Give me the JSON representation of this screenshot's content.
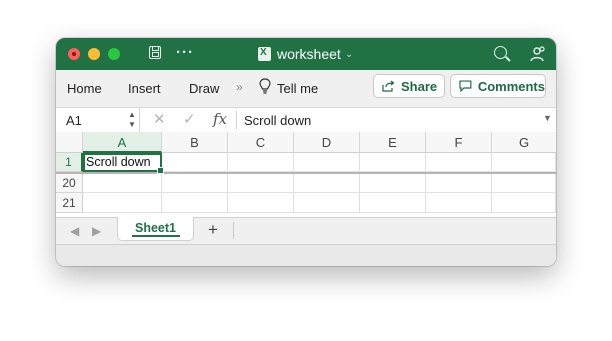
{
  "window": {
    "title": "worksheet"
  },
  "ribbon": {
    "tabs": [
      "Home",
      "Insert",
      "Draw"
    ],
    "overflow": "»",
    "tell_me": "Tell me",
    "share_label": "Share",
    "comments_label": "Comments"
  },
  "formula_bar": {
    "name_box": "A1",
    "fx_label": "fx",
    "content": "Scroll down"
  },
  "sheet": {
    "columns": [
      "A",
      "B",
      "C",
      "D",
      "E",
      "F",
      "G"
    ],
    "rows": [
      "1",
      "20",
      "21"
    ],
    "cells": {
      "A1": "Scroll down"
    },
    "selected": "A1"
  },
  "sheet_tabs": {
    "tabs": [
      "Sheet1"
    ],
    "add_label": "+"
  },
  "colors": {
    "accent": "#207245",
    "ribbon_bg": "#f0f0f0"
  }
}
